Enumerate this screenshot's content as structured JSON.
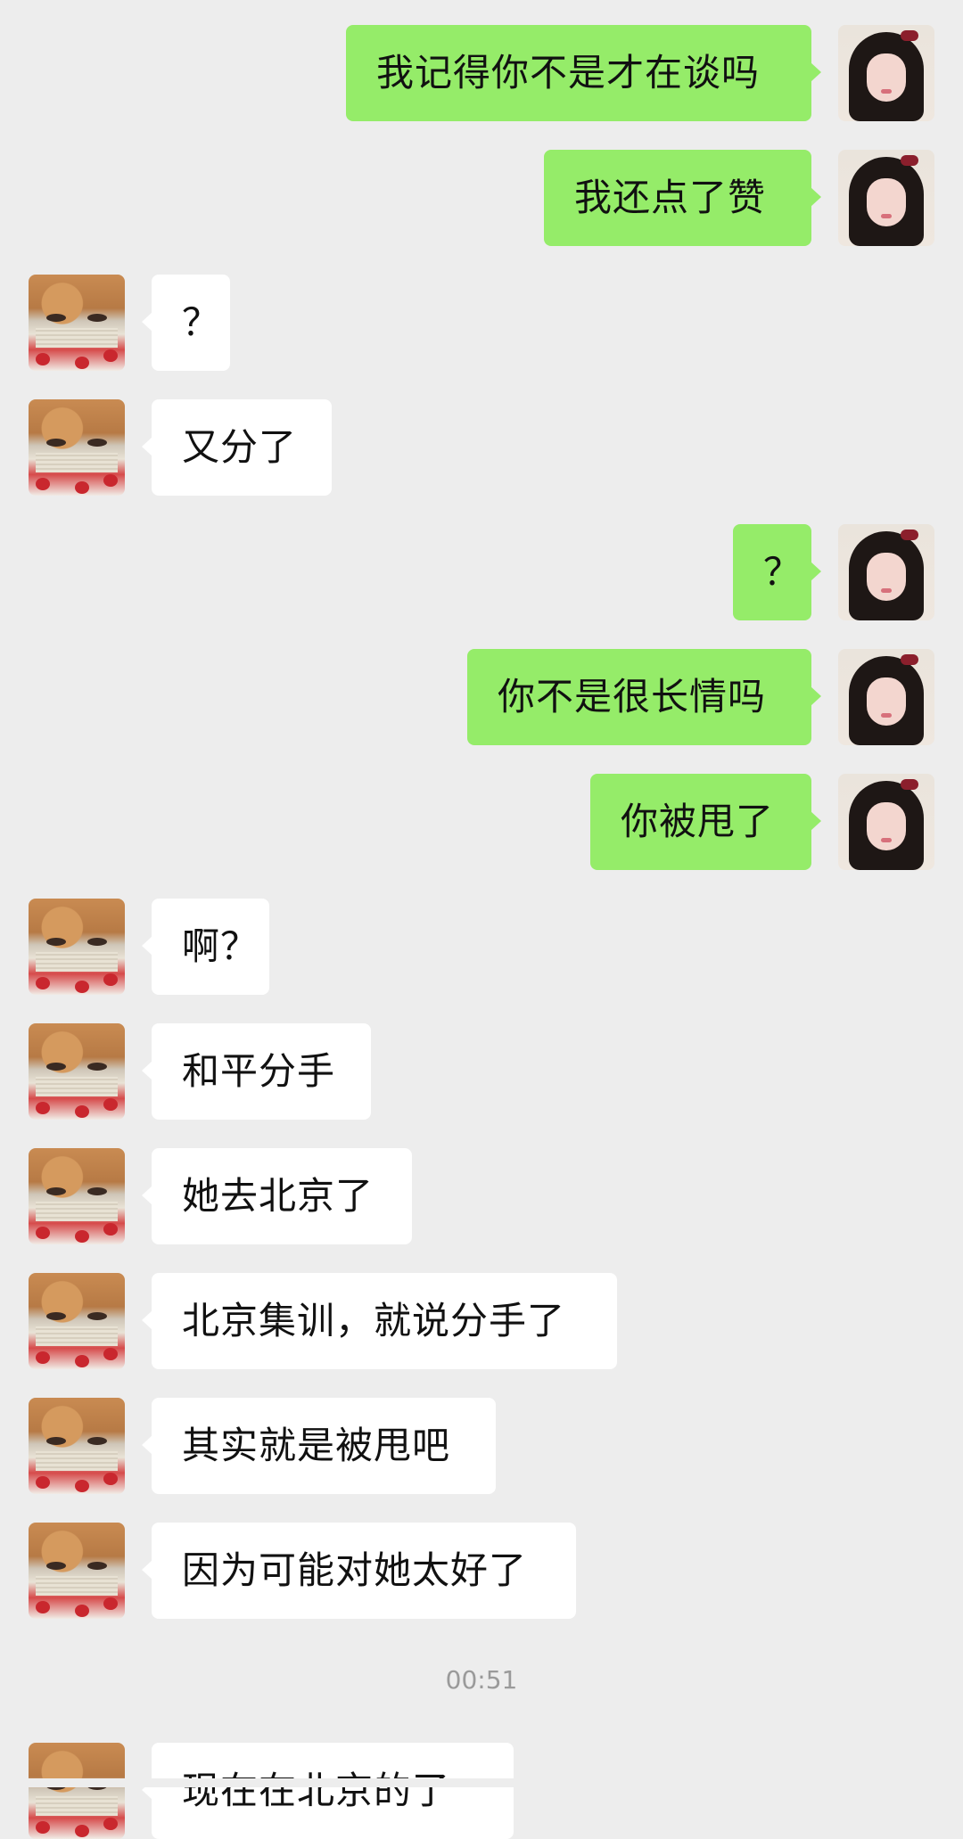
{
  "messages": [
    {
      "side": "out",
      "text": "我记得你不是才在谈吗"
    },
    {
      "side": "out",
      "text": "我还点了赞"
    },
    {
      "side": "in",
      "text": "？"
    },
    {
      "side": "in",
      "text": "又分了"
    },
    {
      "side": "out",
      "text": "？"
    },
    {
      "side": "out",
      "text": "你不是很长情吗"
    },
    {
      "side": "out",
      "text": "你被甩了"
    },
    {
      "side": "in",
      "text": "啊？"
    },
    {
      "side": "in",
      "text": "和平分手"
    },
    {
      "side": "in",
      "text": "她去北京了"
    },
    {
      "side": "in",
      "text": "北京集训，就说分手了"
    },
    {
      "side": "in",
      "text": "其实就是被甩吧"
    },
    {
      "side": "in",
      "text": "因为可能对她太好了"
    },
    {
      "side": "in",
      "text": "现在在北京的了"
    }
  ],
  "timestamp": "00:51",
  "colors": {
    "background": "#ededed",
    "outgoing_bubble": "#95ec69",
    "incoming_bubble": "#ffffff",
    "timestamp_text": "#9a9a9a"
  },
  "icons": {
    "peer_avatar": "avatar-peer-icon",
    "self_avatar": "avatar-self-icon"
  }
}
